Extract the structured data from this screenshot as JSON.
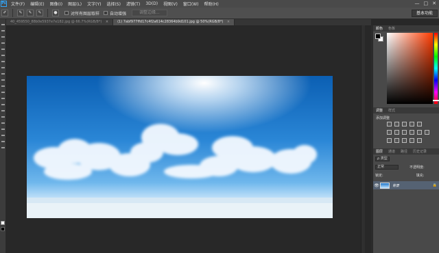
{
  "menubar": {
    "logo": "Ps",
    "items": [
      "文件(F)",
      "编辑(E)",
      "图像(I)",
      "图层(L)",
      "文字(Y)",
      "选择(S)",
      "滤镜(T)",
      "3D(D)",
      "视图(V)",
      "窗口(W)",
      "帮助(H)"
    ],
    "minimize": "—",
    "maximize": "□",
    "close": "✕"
  },
  "options": {
    "sample_all_layers": "对所有图层取样",
    "auto_enhance": "自动增强",
    "refine_edge": "调整边缘...",
    "workspace": "基本功能"
  },
  "tabs": [
    {
      "label": "40_459550_88b0e5937e7e182.jpg @ 66.7%(RGB/8*)",
      "close": "×"
    },
    {
      "label": "(1) 7abf977ffd17c4f2a614c28364b9d101.jpg @ 50%(RGB/8*)",
      "close": "×"
    }
  ],
  "color_panel": {
    "tabs": [
      "颜色",
      "色板"
    ],
    "fg_color": "#000000",
    "bg_color": "#ffffff",
    "accent_hue": "#ff3b00"
  },
  "adjust_panel": {
    "tabs": [
      "调整",
      "样式"
    ],
    "title": "添加调整"
  },
  "layers_panel": {
    "tabs": [
      "图层",
      "通道",
      "路径",
      "历史记录"
    ],
    "filter_label": "ρ 类型",
    "blend_mode": "正常",
    "opacity_label": "不透明度:",
    "lock_label": "锁定:",
    "fill_label": "填充:",
    "layer_name": "背景",
    "lock_icon": "🔒"
  }
}
